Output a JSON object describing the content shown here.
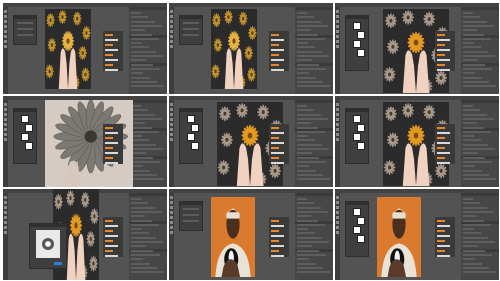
{
  "layout": {
    "columns": 3,
    "rows": 3
  },
  "app": {
    "name": "",
    "theme": "dark"
  },
  "colors": {
    "ui_bg": "#535353",
    "panel_bg": "#474747",
    "dialog_bg": "#3f3f3f",
    "accent_orange": "#e8862a",
    "accent_blue": "#2f7fd6",
    "logo_teal": "#1ab7c5"
  },
  "tiles": [
    {
      "scene": "flowers-gold-hands",
      "dialog": "curves-small"
    },
    {
      "scene": "flowers-gold-hands",
      "dialog": "curves-small"
    },
    {
      "scene": "flowers-dark-hands",
      "dialog": "swatches"
    },
    {
      "scene": "flower-zoom-dark",
      "dialog": "swatches"
    },
    {
      "scene": "flowers-dark-orange-center",
      "dialog": "swatches"
    },
    {
      "scene": "flowers-dark-orange-center",
      "dialog": "swatches"
    },
    {
      "scene": "flowers-dark-dialog-open",
      "dialog": "camera-raw"
    },
    {
      "scene": "portrait-man-dog-orange",
      "dialog": "curves-small"
    },
    {
      "scene": "portrait-man-dog-orange",
      "dialog": "swatches"
    }
  ]
}
